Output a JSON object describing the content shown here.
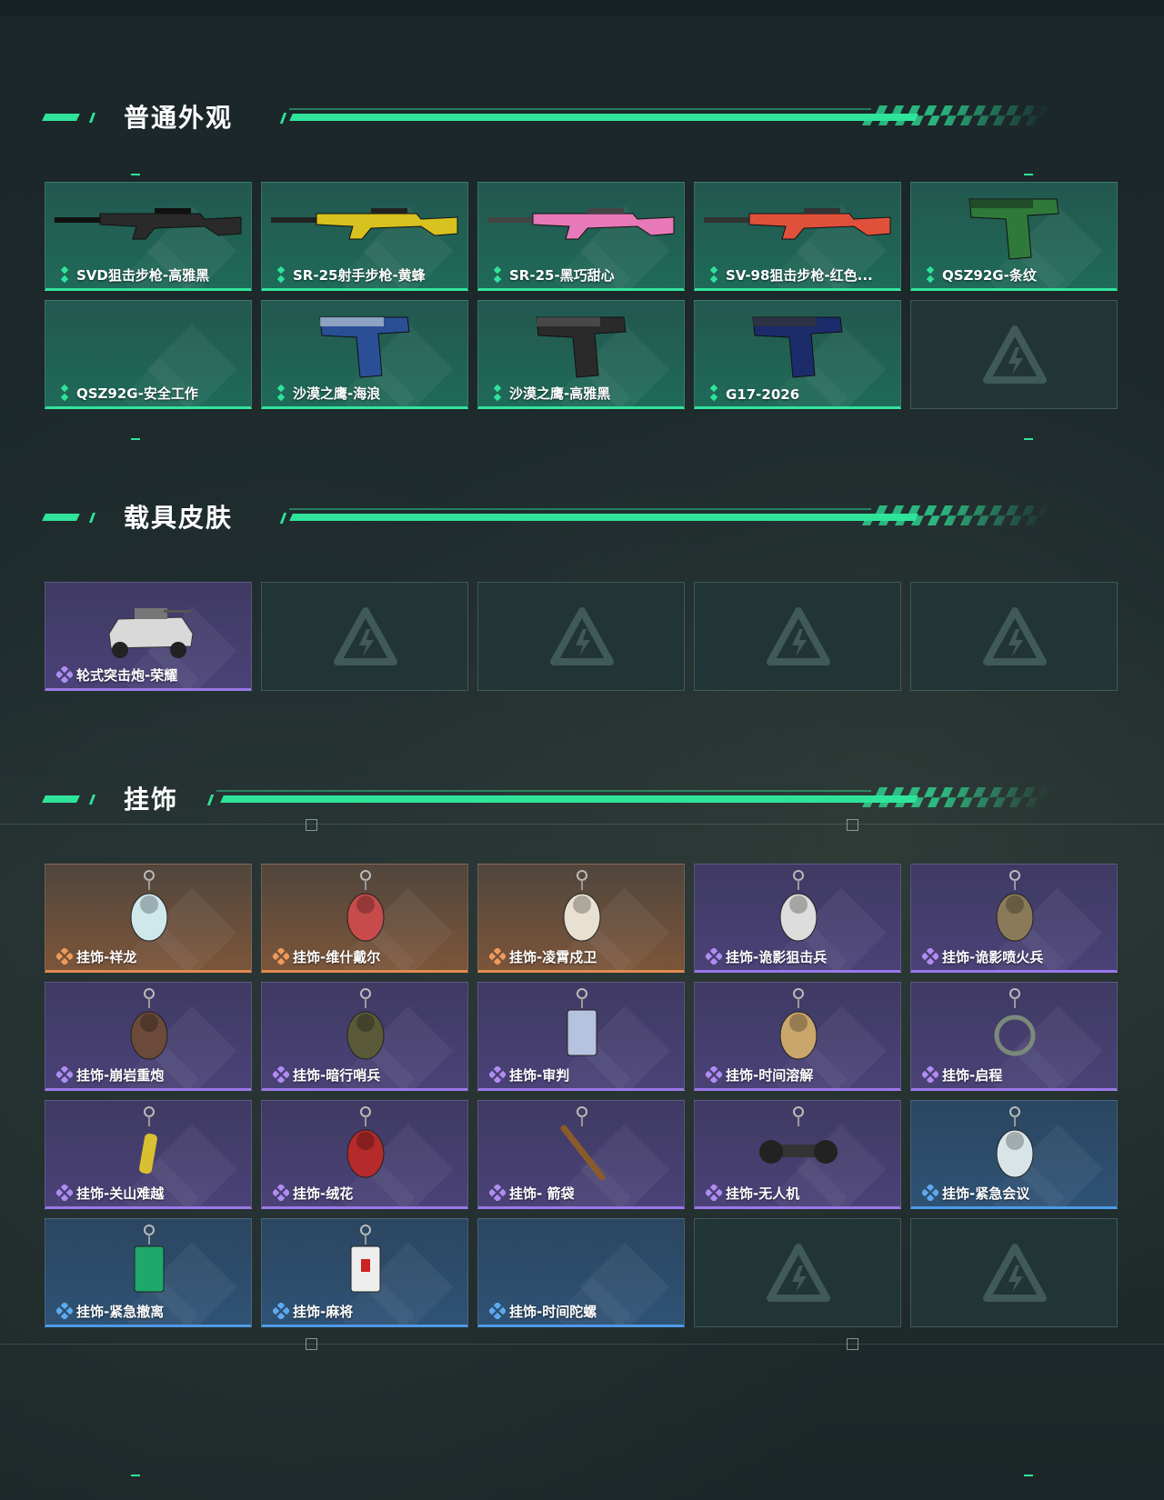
{
  "sections": [
    {
      "title": "普通外观",
      "items": [
        {
          "label": "SVD狙击步枪-高雅黑",
          "rarity": "green",
          "icon": "rifle-black"
        },
        {
          "label": "SR-25射手步枪-黄蜂",
          "rarity": "green",
          "icon": "rifle-yellow"
        },
        {
          "label": "SR-25-黑巧甜心",
          "rarity": "green",
          "icon": "rifle-pink"
        },
        {
          "label": "SV-98狙击步枪-红色...",
          "rarity": "green",
          "icon": "rifle-red"
        },
        {
          "label": "QSZ92G-条纹",
          "rarity": "green",
          "icon": "pistol-green"
        },
        {
          "label": "QSZ92G-安全工作",
          "rarity": "green",
          "icon": "none"
        },
        {
          "label": "沙漠之鹰-海浪",
          "rarity": "green",
          "icon": "pistol-blue"
        },
        {
          "label": "沙漠之鹰-高雅黑",
          "rarity": "green",
          "icon": "pistol-black"
        },
        {
          "label": "G17-2026",
          "rarity": "green",
          "icon": "pistol-navy"
        },
        {
          "label": "",
          "rarity": "empty",
          "icon": "logo"
        }
      ]
    },
    {
      "title": "载具皮肤",
      "items": [
        {
          "label": "轮式突击炮-荣耀",
          "rarity": "purple",
          "icon": "vehicle"
        },
        {
          "label": "",
          "rarity": "empty",
          "icon": "logo"
        },
        {
          "label": "",
          "rarity": "empty",
          "icon": "logo"
        },
        {
          "label": "",
          "rarity": "empty",
          "icon": "logo"
        },
        {
          "label": "",
          "rarity": "empty",
          "icon": "logo"
        }
      ]
    },
    {
      "title": "挂饰",
      "items": [
        {
          "label": "挂饰-祥龙",
          "rarity": "orange",
          "icon": "charm-dragon"
        },
        {
          "label": "挂饰-维什戴尔",
          "rarity": "orange",
          "icon": "charm-figure"
        },
        {
          "label": "挂饰-凌霄戍卫",
          "rarity": "orange",
          "icon": "charm-bird"
        },
        {
          "label": "挂饰-诡影狙击兵",
          "rarity": "purple",
          "icon": "charm-sniper"
        },
        {
          "label": "挂饰-诡影喷火兵",
          "rarity": "purple",
          "icon": "charm-flamer"
        },
        {
          "label": "挂饰-崩岩重炮",
          "rarity": "purple",
          "icon": "charm-rock"
        },
        {
          "label": "挂饰-暗行哨兵",
          "rarity": "purple",
          "icon": "charm-sentry"
        },
        {
          "label": "挂饰-审判",
          "rarity": "purple",
          "icon": "charm-card"
        },
        {
          "label": "挂饰-时间溶解",
          "rarity": "purple",
          "icon": "charm-clock"
        },
        {
          "label": "挂饰-启程",
          "rarity": "purple",
          "icon": "charm-ring"
        },
        {
          "label": "挂饰-关山难越",
          "rarity": "purple",
          "icon": "charm-bullet"
        },
        {
          "label": "挂饰-绒花",
          "rarity": "purple",
          "icon": "charm-flower"
        },
        {
          "label": "挂饰- 箭袋",
          "rarity": "purple",
          "icon": "charm-quiver"
        },
        {
          "label": "挂饰-无人机",
          "rarity": "purple",
          "icon": "charm-drone"
        },
        {
          "label": "挂饰-紧急会议",
          "rarity": "blue",
          "icon": "charm-meeting"
        },
        {
          "label": "挂饰-紧急撤离",
          "rarity": "blue",
          "icon": "charm-evac"
        },
        {
          "label": "挂饰-麻将",
          "rarity": "blue",
          "icon": "charm-mahjong"
        },
        {
          "label": "挂饰-时间陀螺",
          "rarity": "blue",
          "icon": "none"
        },
        {
          "label": "",
          "rarity": "empty",
          "icon": "logo"
        },
        {
          "label": "",
          "rarity": "empty",
          "icon": "logo"
        }
      ]
    }
  ],
  "colors": {
    "accent": "#2fe49a",
    "green": "#33e49e",
    "purple": "#9a78e8",
    "orange": "#e28a4e",
    "blue": "#4d9ae8"
  }
}
